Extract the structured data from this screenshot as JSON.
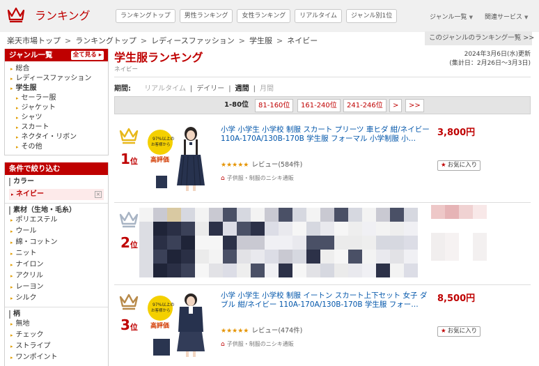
{
  "header": {
    "logo_text": "ランキング",
    "nav": [
      "ランキングトップ",
      "男性ランキング",
      "女性ランキング",
      "リアルタイム",
      "ジャンル別1位"
    ],
    "right_links": [
      "ジャンル一覧",
      "関連サービス"
    ]
  },
  "breadcrumb": [
    "楽天市場トップ",
    "ランキングトップ",
    "レディースファッション",
    "学生服",
    "ネイビー"
  ],
  "genre_link": "このジャンルのランキング一覧 >>",
  "sidebar": {
    "genre_title": "ジャンル一覧",
    "all_label": "全て見る",
    "genres": [
      {
        "label": "総合",
        "level": 0
      },
      {
        "label": "レディースファッション",
        "level": 0
      },
      {
        "label": "学生服",
        "level": 0,
        "bold": true
      },
      {
        "label": "セーラー服",
        "level": 1
      },
      {
        "label": "ジャケット",
        "level": 1
      },
      {
        "label": "シャツ",
        "level": 1
      },
      {
        "label": "スカート",
        "level": 1
      },
      {
        "label": "ネクタイ・リボン",
        "level": 1
      },
      {
        "label": "その他",
        "level": 1
      }
    ],
    "filter_title": "条件で絞り込む",
    "color_title": "カラー",
    "color_selected": "ネイビー",
    "material_title": "素材（生地・毛糸）",
    "materials": [
      "ポリエステル",
      "ウール",
      "綿・コットン",
      "ニット",
      "ナイロン",
      "アクリル",
      "レーヨン",
      "シルク"
    ],
    "pattern_title": "柄",
    "patterns": [
      "無地",
      "チェック",
      "ストライプ",
      "ワンポイント"
    ]
  },
  "main": {
    "title": "学生服ランキング",
    "subgenre": "ネイビー",
    "date_line1": "2024年3月6日(水)更新",
    "date_line2": "(集計日：2月26日～3月3日)",
    "period_label": "期間:",
    "periods": [
      "リアルタイム",
      "デイリー",
      "週間",
      "月間"
    ],
    "active_period": "週間",
    "pager": {
      "current": "1-80位",
      "pages": [
        "81-160位",
        "161-240位",
        "241-246位"
      ],
      "next": ">",
      "last": ">>"
    }
  },
  "items": [
    {
      "rank_num": "1",
      "rank_suffix": "位",
      "crown_color": "#e8b81a",
      "title": "小学 小学生 小学校 制服 スカート プリーツ 車ヒダ 紺/ネイビー 110A-170A/130B-170B 学生服 フォーマル 小学制服 小…",
      "stars": "★★★★★",
      "reviews": "レビュー(584件)",
      "shop": "子供服・制服のニシキ通販",
      "price": "3,800円",
      "fav": "お気に入り",
      "badge_line1": "97%以上の",
      "badge_line2": "お客様から",
      "badge_line3": "高評価"
    },
    {
      "rank_num": "2",
      "rank_suffix": "位",
      "crown_color": "#a8b4c4"
    },
    {
      "rank_num": "3",
      "rank_suffix": "位",
      "crown_color": "#b88a4a",
      "title": "小学 小学生 小学校 制服 イートン スカート上下セット 女子 ダブル 紺/ネイビー 110A-170A/130B-170B 学生服 フォー…",
      "stars": "★★★★★",
      "reviews": "レビュー(474件)",
      "shop": "子供服・制服のニシキ通販",
      "price": "8,500円",
      "fav": "お気に入り",
      "badge_line1": "97%以上の",
      "badge_line2": "お客様から",
      "badge_line3": "高評価"
    }
  ],
  "colors": {
    "brand_red": "#bf0000",
    "star": "#e59400",
    "link_blue": "#0055aa"
  }
}
